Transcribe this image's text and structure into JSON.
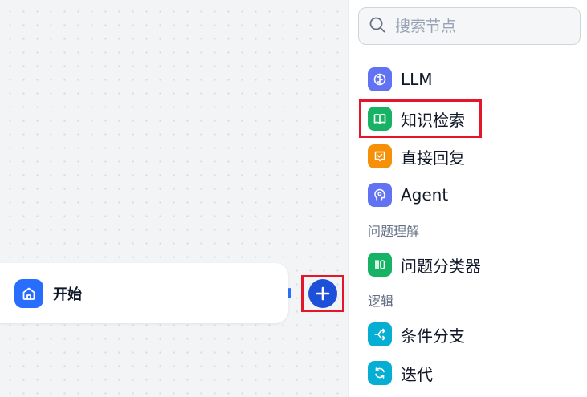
{
  "canvas": {
    "start_node": {
      "label": "开始",
      "icon": "home-icon",
      "icon_color": "#296dff"
    },
    "add_button": {
      "icon": "plus-icon",
      "color": "#1d4fd8"
    }
  },
  "panel": {
    "search": {
      "placeholder": "搜索节点",
      "value": ""
    },
    "items": [
      {
        "label": "LLM",
        "icon": "brain-icon",
        "color": "#6172f3"
      },
      {
        "label": "知识检索",
        "icon": "book-icon",
        "color": "#16b364"
      },
      {
        "label": "直接回复",
        "icon": "message-check-icon",
        "color": "#f79009"
      },
      {
        "label": "Agent",
        "icon": "agent-head-icon",
        "color": "#6172f3"
      }
    ],
    "sections": [
      {
        "title": "问题理解",
        "items": [
          {
            "label": "问题分类器",
            "icon": "classifier-icon",
            "color": "#16b364"
          }
        ]
      },
      {
        "title": "逻辑",
        "items": [
          {
            "label": "条件分支",
            "icon": "branch-icon",
            "color": "#06aed4"
          },
          {
            "label": "迭代",
            "icon": "loop-icon",
            "color": "#06aed4"
          }
        ]
      }
    ]
  },
  "highlight_color": "#e3162a"
}
